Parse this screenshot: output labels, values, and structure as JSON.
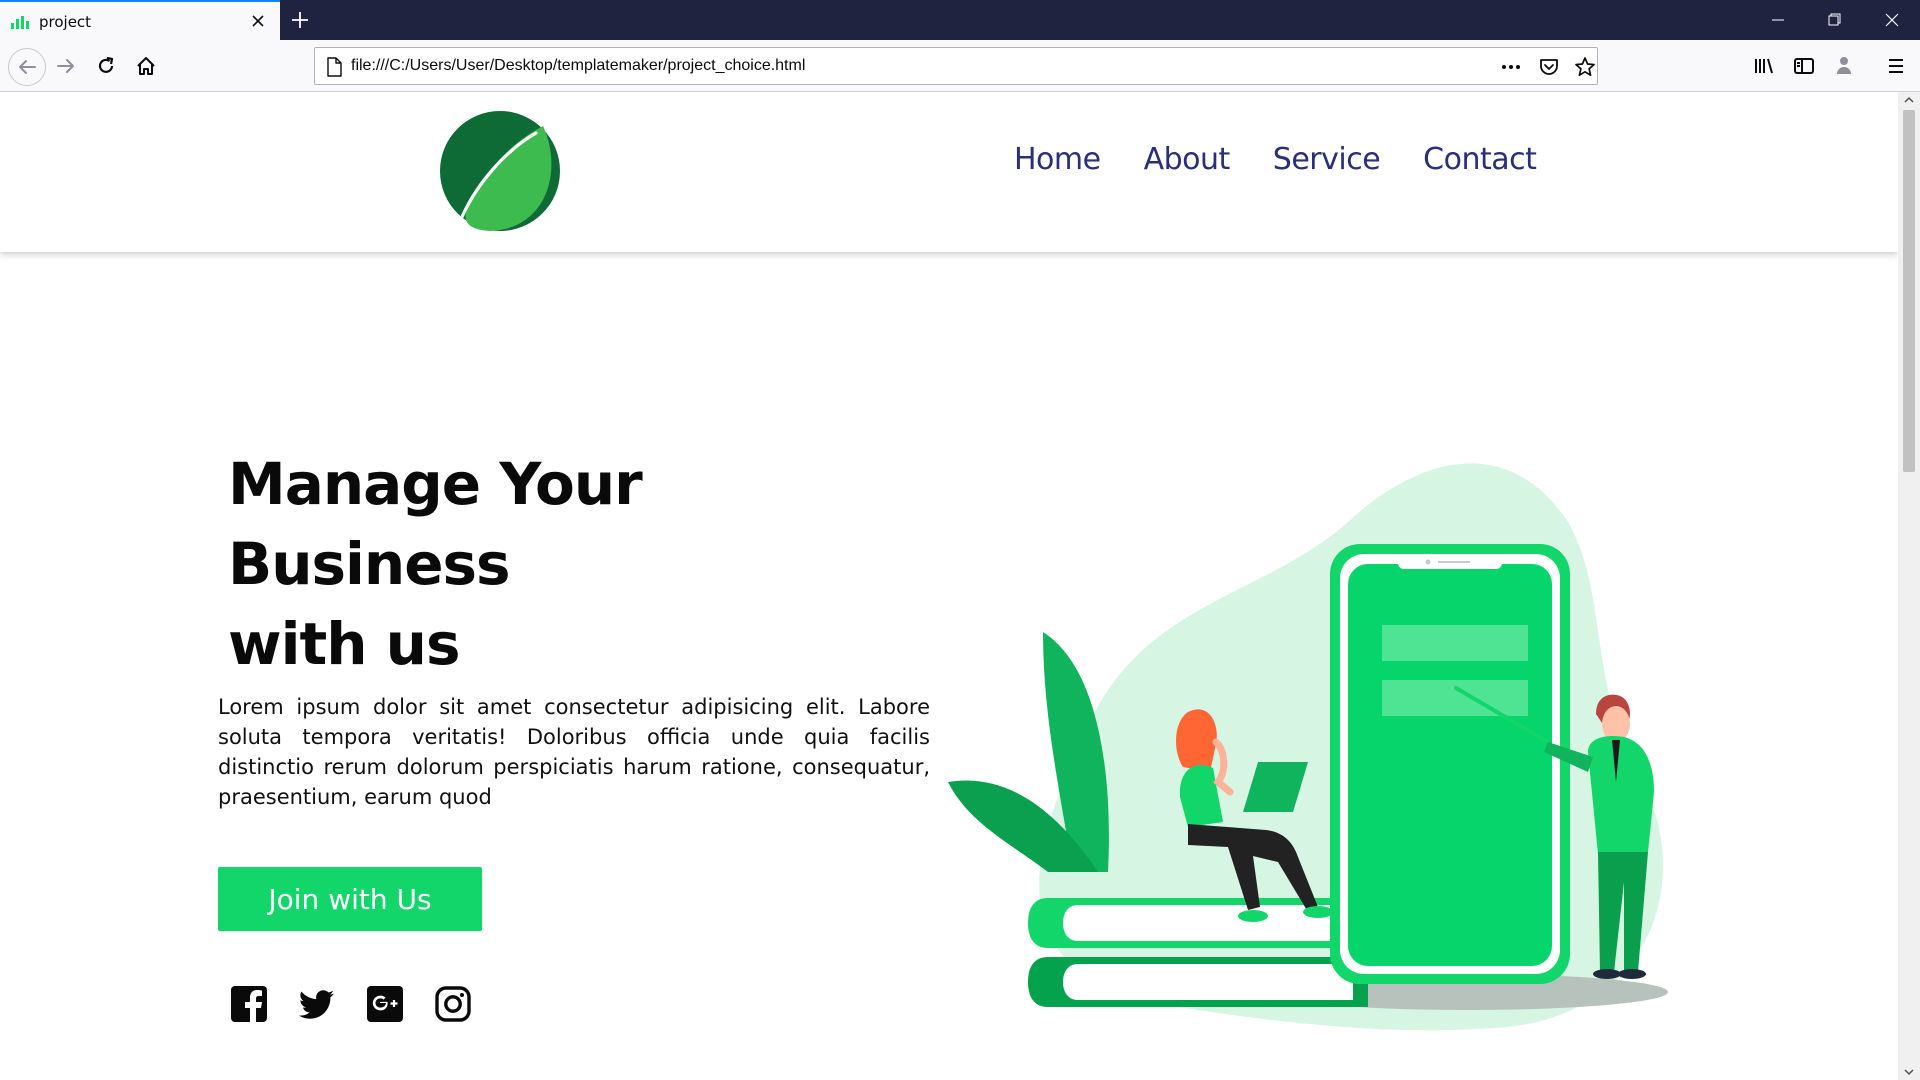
{
  "browser": {
    "tab": {
      "title": "project",
      "favicon": "chart-favicon-icon"
    },
    "url": "file:///C:/Users/User/Desktop/templatemaker/project_choice.html"
  },
  "site": {
    "nav": [
      "Home",
      "About",
      "Service",
      "Contact"
    ],
    "hero": {
      "title_line1": "Manage Your Business",
      "title_line2": "with us",
      "text": "Lorem ipsum dolor sit amet consectetur adipisicing elit. Labore soluta tempora veritatis! Doloribus officia unde quia facilis distinctio rerum dolorum perspiciatis harum ratione, consequatur, praesentium, earum quod",
      "button": "Join with Us"
    },
    "socials": [
      "facebook-icon",
      "twitter-icon",
      "google-plus-icon",
      "instagram-icon"
    ]
  },
  "colors": {
    "accent": "#12d66a",
    "nav_text": "#2b2e7a",
    "tab_bar": "#202340",
    "logo_dark": "#0e6b36",
    "logo_light": "#3dbb4f"
  }
}
